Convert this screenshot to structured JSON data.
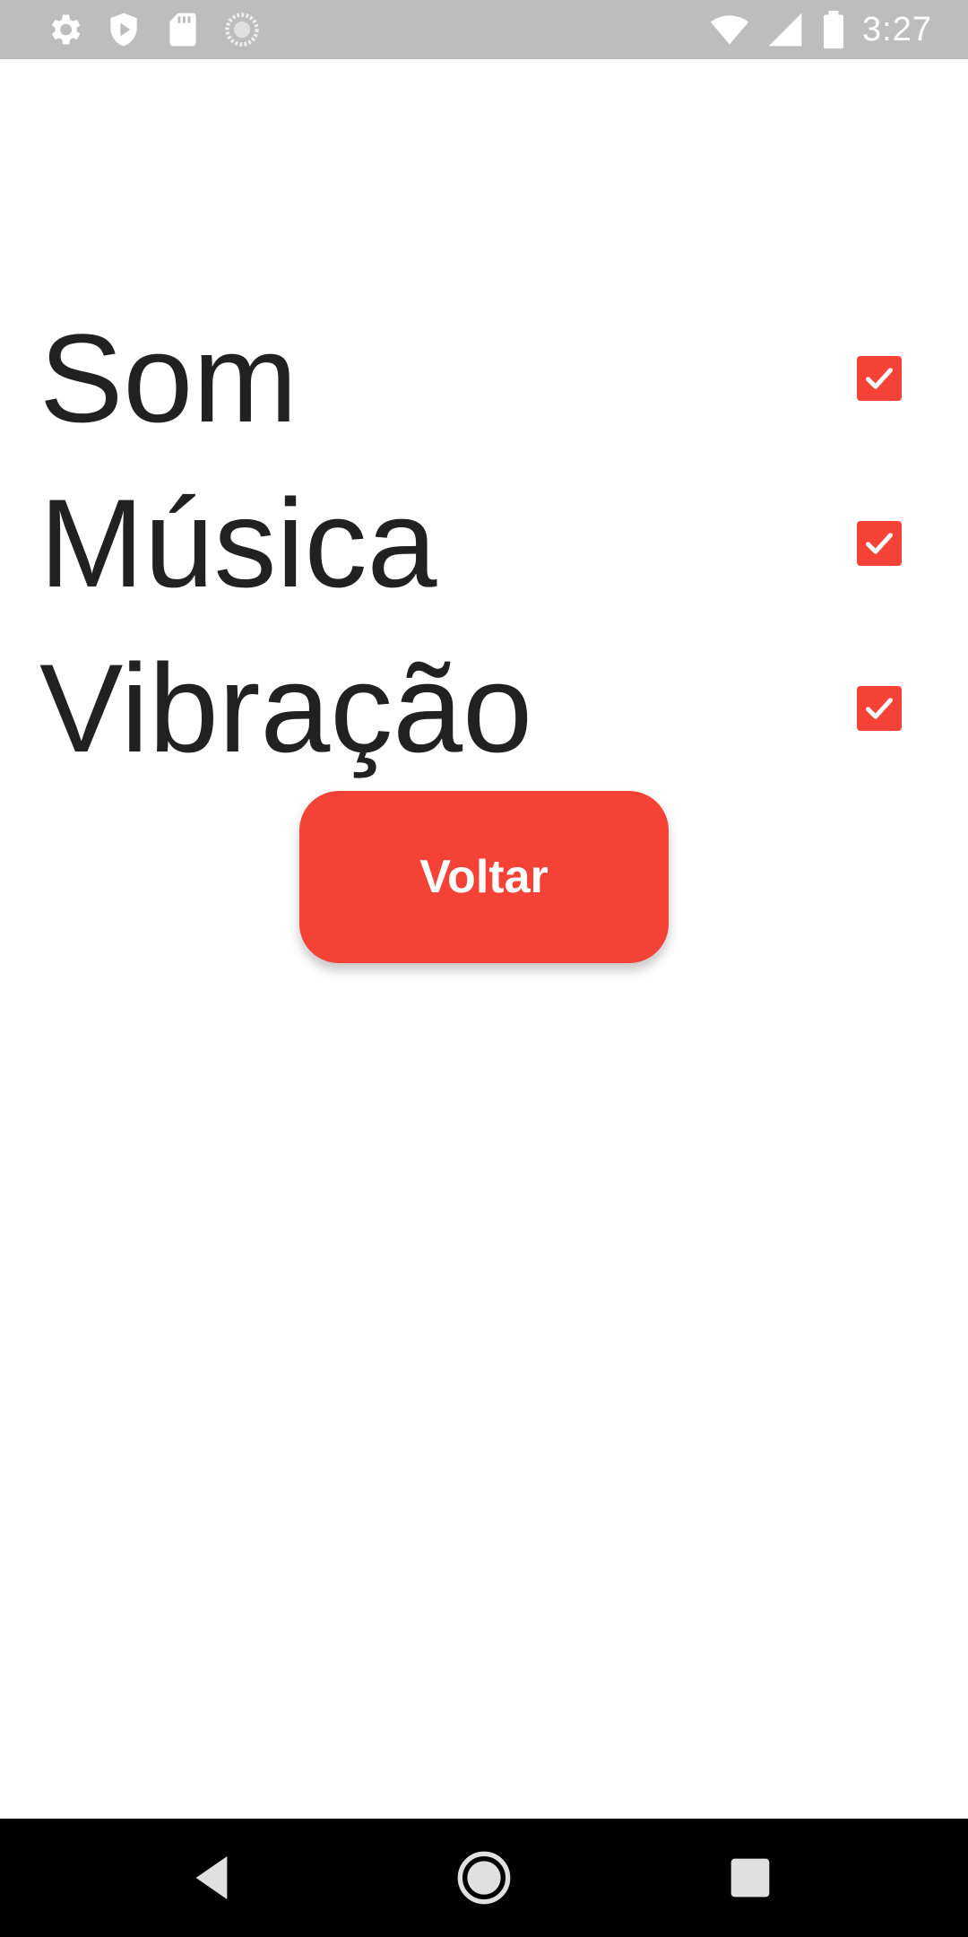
{
  "status_bar": {
    "time": "3:27",
    "left_icons": [
      "gear-icon",
      "shield-play-icon",
      "sd-card-icon",
      "loading-circle-icon"
    ],
    "right_icons": [
      "wifi-icon",
      "cell-signal-icon",
      "battery-icon"
    ]
  },
  "settings": {
    "items": [
      {
        "label": "Som",
        "checked": true
      },
      {
        "label": "Música",
        "checked": true
      },
      {
        "label": "Vibração",
        "checked": true
      }
    ]
  },
  "actions": {
    "back_label": "Voltar"
  },
  "colors": {
    "accent": "#f44336",
    "text": "#212121",
    "status_bar": "#bdbdbd",
    "nav_bar": "#000000"
  }
}
